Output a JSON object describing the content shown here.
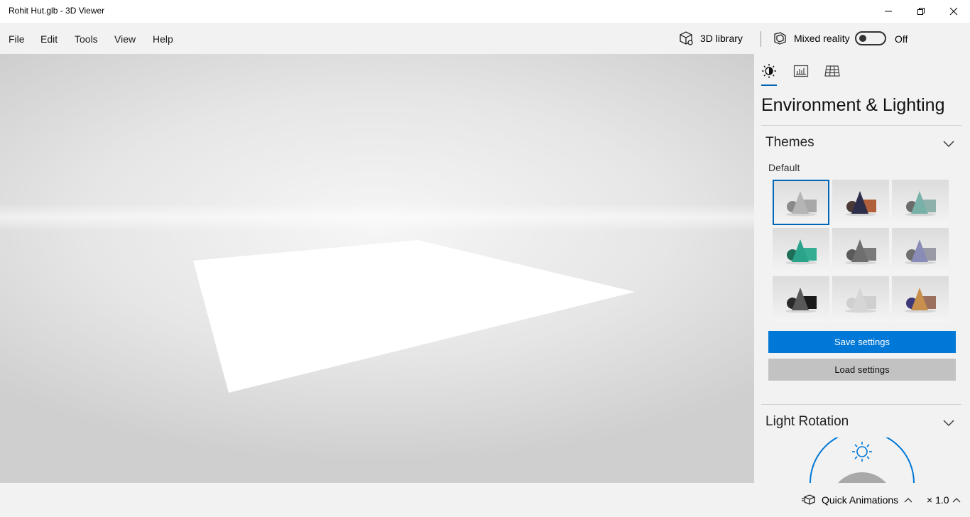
{
  "window": {
    "title": "Rohit Hut.glb - 3D Viewer",
    "controls": [
      "minimize-icon",
      "restore-icon",
      "close-icon"
    ]
  },
  "menu": {
    "items": [
      "File",
      "Edit",
      "Tools",
      "View",
      "Help"
    ]
  },
  "toolbar": {
    "library_label": "3D library",
    "mixed_reality_label": "Mixed reality",
    "toggle_state": "Off",
    "toggle_on": false
  },
  "panel": {
    "tabs": [
      "lighting-tab-icon",
      "stats-tab-icon",
      "grid-tab-icon"
    ],
    "active_tab": 0,
    "title": "Environment & Lighting",
    "themes_section": {
      "heading": "Themes",
      "subheading": "Default",
      "selected_index": 0,
      "swatches": [
        {
          "name": "default-gray",
          "sphere": "#8a8a8a",
          "cone": "#b5b5b5",
          "box": "#a8a8a8"
        },
        {
          "name": "warm-dark",
          "sphere": "#4a3a36",
          "cone": "#2d2f4a",
          "box": "#b0603a"
        },
        {
          "name": "teal-gray",
          "sphere": "#6b6b6b",
          "cone": "#78b1a8",
          "box": "#8fb1ab"
        },
        {
          "name": "emerald",
          "sphere": "#1e6e58",
          "cone": "#2aa38a",
          "box": "#35ad93"
        },
        {
          "name": "charcoal",
          "sphere": "#5a5a5a",
          "cone": "#6e6e6e",
          "box": "#7a7a7a"
        },
        {
          "name": "lavender",
          "sphere": "#6f6f6f",
          "cone": "#8a8cb8",
          "box": "#9a9aa6"
        },
        {
          "name": "noir",
          "sphere": "#2a2a2a",
          "cone": "#585858",
          "box": "#1a1a1a"
        },
        {
          "name": "pale",
          "sphere": "#cfcfcf",
          "cone": "#d6d6d6",
          "box": "#cfcfcf"
        },
        {
          "name": "copper-violet",
          "sphere": "#3e3a7a",
          "cone": "#c8904c",
          "box": "#9b705c"
        }
      ],
      "save_label": "Save settings",
      "load_label": "Load settings"
    },
    "light_rotation_section": {
      "heading": "Light Rotation"
    }
  },
  "statusbar": {
    "quick_animations_label": "Quick Animations",
    "speed_label": "× 1.0"
  },
  "colors": {
    "accent": "#0078d7",
    "selection": "#0067b8",
    "panel_bg": "#f2f2f2"
  }
}
